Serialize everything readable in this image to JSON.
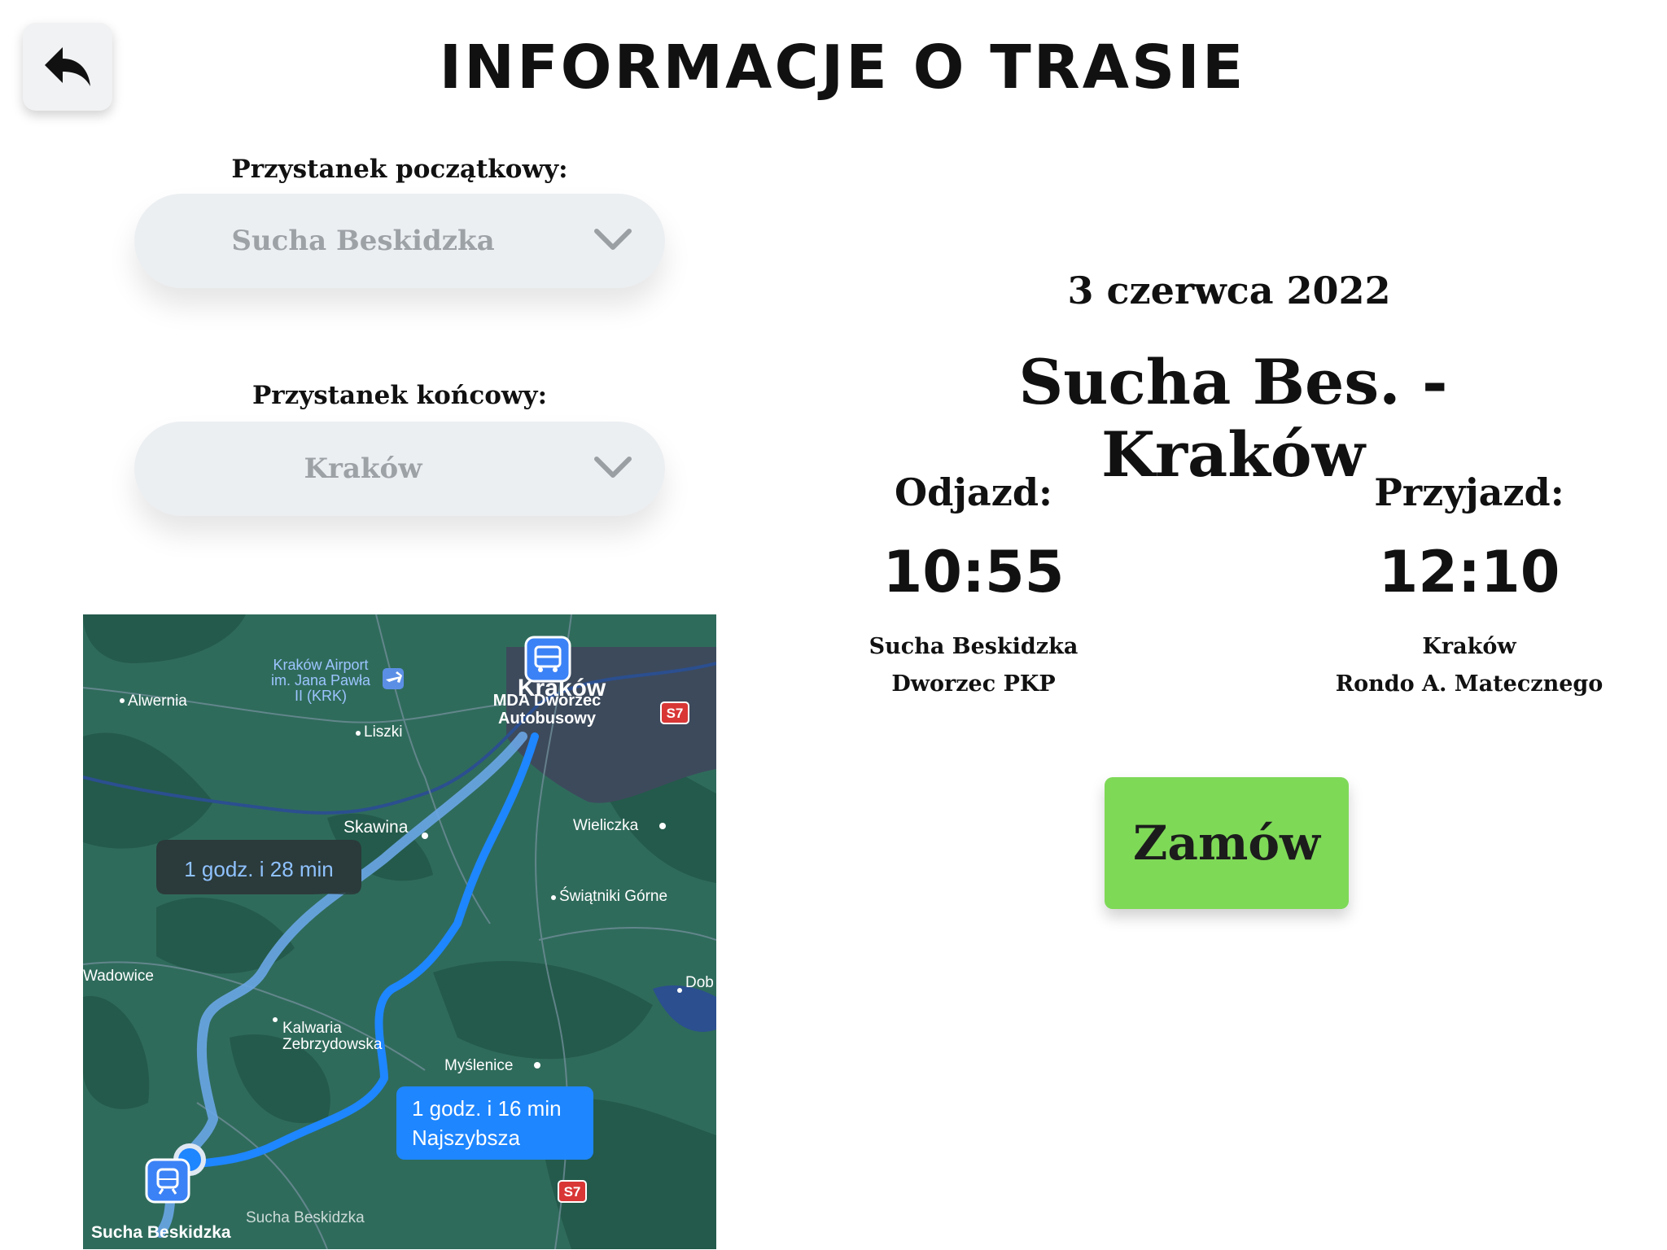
{
  "header": {
    "title": "INFORMACJE O TRASIE"
  },
  "form": {
    "start_label": "Przystanek początkowy:",
    "start_value": "Sucha Beskidzka",
    "end_label": "Przystanek końcowy:",
    "end_value": "Kraków"
  },
  "trip": {
    "date": "3 czerwca 2022",
    "route": "Sucha Bes. - Kraków",
    "departure": {
      "label": "Odjazd:",
      "time": "10:55",
      "stop_line1": "Sucha Beskidzka",
      "stop_line2": "Dworzec PKP"
    },
    "arrival": {
      "label": "Przyjazd:",
      "time": "12:10",
      "stop_line1": "Kraków",
      "stop_line2": "Rondo A. Matecznego"
    },
    "order_label": "Zamów"
  },
  "map": {
    "places": {
      "airport": [
        "Kraków Airport",
        "im. Jana Pawła",
        "II (KRK)"
      ],
      "alwernia": "Alwernia",
      "liszki": "Liszki",
      "krakow": "Kraków",
      "mda": [
        "MDA Dworzec",
        "Autobusowy"
      ],
      "s7": "S7",
      "skawina": "Skawina",
      "wieliczka": "Wieliczka",
      "swiatniki": "Świątniki Górne",
      "wadowice": "Wadowice",
      "dob": "Dob",
      "kalwaria": [
        "Kalwaria",
        "Zebrzydowska"
      ],
      "myslenice": "Myślenice",
      "sucha_faded": "Sucha Beskidzka",
      "sucha": "Sucha Beskidzka"
    },
    "route_alt": "1 godz. i 28 min",
    "route_fast": "1 godz. i 16 min",
    "route_fast_note": "Najszybsza",
    "colors": {
      "land": "#2f6b5b",
      "city": "#3d4a5c",
      "route": "#1e86ff",
      "route_alt": "#6aa6e6"
    }
  }
}
